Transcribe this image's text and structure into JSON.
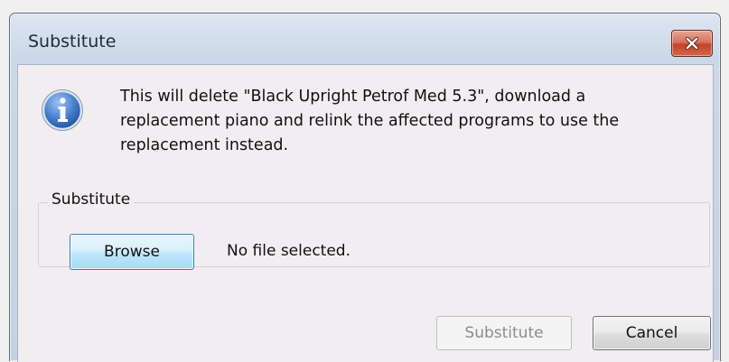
{
  "window": {
    "title": "Substitute"
  },
  "title_buttons": {
    "close_icon": "close-x-icon"
  },
  "message": {
    "icon": "information-icon",
    "text": "This will delete \"Black Upright Petrof Med 5.3\", download a replacement piano and relink the affected programs to use the replacement instead."
  },
  "substitute_group": {
    "legend": "Substitute",
    "browse_label": "Browse",
    "file_status": "No file selected."
  },
  "buttons": {
    "substitute_label": "Substitute",
    "substitute_enabled": false,
    "cancel_label": "Cancel"
  },
  "colors": {
    "close_button": "#c7472e",
    "info_icon": "#3d6fc0",
    "focused_button": "#3c7fb1"
  }
}
